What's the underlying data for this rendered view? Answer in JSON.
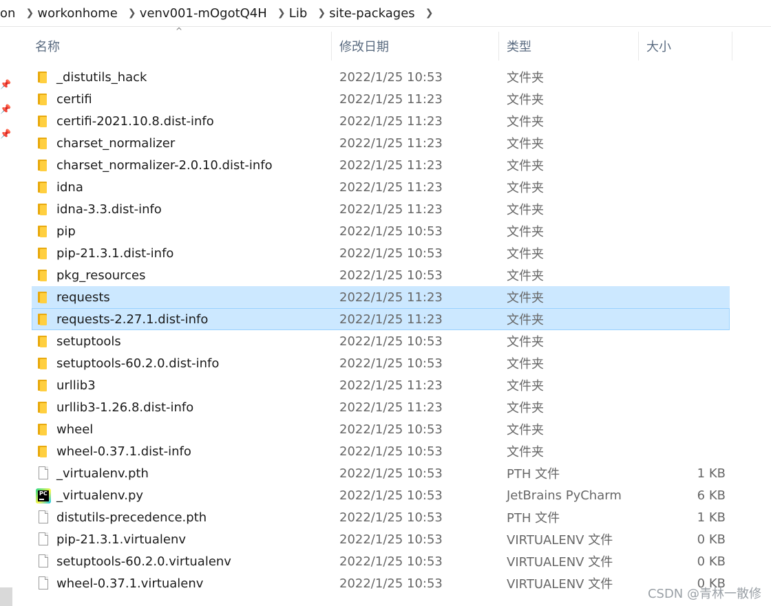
{
  "breadcrumb": [
    "on",
    "workonhome",
    "venv001-mOgotQ4H",
    "Lib",
    "site-packages"
  ],
  "breadcrumb_sep": "❯",
  "columns": {
    "name": "名称",
    "date": "修改日期",
    "type": "类型",
    "size": "大小"
  },
  "sort_indicator": "^",
  "pin_glyph": "📌",
  "rows": [
    {
      "name": "_distutils_hack",
      "date": "2022/1/25 10:53",
      "type": "文件夹",
      "size": "",
      "icon": "folder-icon"
    },
    {
      "name": "certifi",
      "date": "2022/1/25 11:23",
      "type": "文件夹",
      "size": "",
      "icon": "folder-icon"
    },
    {
      "name": "certifi-2021.10.8.dist-info",
      "date": "2022/1/25 11:23",
      "type": "文件夹",
      "size": "",
      "icon": "folder-icon"
    },
    {
      "name": "charset_normalizer",
      "date": "2022/1/25 11:23",
      "type": "文件夹",
      "size": "",
      "icon": "folder-icon"
    },
    {
      "name": "charset_normalizer-2.0.10.dist-info",
      "date": "2022/1/25 11:23",
      "type": "文件夹",
      "size": "",
      "icon": "folder-icon"
    },
    {
      "name": "idna",
      "date": "2022/1/25 11:23",
      "type": "文件夹",
      "size": "",
      "icon": "folder-icon"
    },
    {
      "name": "idna-3.3.dist-info",
      "date": "2022/1/25 11:23",
      "type": "文件夹",
      "size": "",
      "icon": "folder-icon"
    },
    {
      "name": "pip",
      "date": "2022/1/25 10:53",
      "type": "文件夹",
      "size": "",
      "icon": "folder-icon"
    },
    {
      "name": "pip-21.3.1.dist-info",
      "date": "2022/1/25 10:53",
      "type": "文件夹",
      "size": "",
      "icon": "folder-icon"
    },
    {
      "name": "pkg_resources",
      "date": "2022/1/25 10:53",
      "type": "文件夹",
      "size": "",
      "icon": "folder-icon"
    },
    {
      "name": "requests",
      "date": "2022/1/25 11:23",
      "type": "文件夹",
      "size": "",
      "icon": "folder-icon",
      "state": "selected"
    },
    {
      "name": "requests-2.27.1.dist-info",
      "date": "2022/1/25 11:23",
      "type": "文件夹",
      "size": "",
      "icon": "folder-icon",
      "state": "focused"
    },
    {
      "name": "setuptools",
      "date": "2022/1/25 10:53",
      "type": "文件夹",
      "size": "",
      "icon": "folder-icon"
    },
    {
      "name": "setuptools-60.2.0.dist-info",
      "date": "2022/1/25 10:53",
      "type": "文件夹",
      "size": "",
      "icon": "folder-icon"
    },
    {
      "name": "urllib3",
      "date": "2022/1/25 11:23",
      "type": "文件夹",
      "size": "",
      "icon": "folder-icon"
    },
    {
      "name": "urllib3-1.26.8.dist-info",
      "date": "2022/1/25 11:23",
      "type": "文件夹",
      "size": "",
      "icon": "folder-icon"
    },
    {
      "name": "wheel",
      "date": "2022/1/25 10:53",
      "type": "文件夹",
      "size": "",
      "icon": "folder-icon"
    },
    {
      "name": "wheel-0.37.1.dist-info",
      "date": "2022/1/25 10:53",
      "type": "文件夹",
      "size": "",
      "icon": "folder-icon"
    },
    {
      "name": "_virtualenv.pth",
      "date": "2022/1/25 10:53",
      "type": "PTH 文件",
      "size": "1 KB",
      "icon": "file-icon"
    },
    {
      "name": "_virtualenv.py",
      "date": "2022/1/25 10:53",
      "type": "JetBrains PyCharm",
      "size": "6 KB",
      "icon": "pycharm-icon"
    },
    {
      "name": "distutils-precedence.pth",
      "date": "2022/1/25 10:53",
      "type": "PTH 文件",
      "size": "1 KB",
      "icon": "file-icon"
    },
    {
      "name": "pip-21.3.1.virtualenv",
      "date": "2022/1/25 10:53",
      "type": "VIRTUALENV 文件",
      "size": "0 KB",
      "icon": "file-icon"
    },
    {
      "name": "setuptools-60.2.0.virtualenv",
      "date": "2022/1/25 10:53",
      "type": "VIRTUALENV 文件",
      "size": "0 KB",
      "icon": "file-icon"
    },
    {
      "name": "wheel-0.37.1.virtualenv",
      "date": "2022/1/25 10:53",
      "type": "VIRTUALENV 文件",
      "size": "0 KB",
      "icon": "file-icon"
    }
  ],
  "pycharm_badge": "PC",
  "watermark": "CSDN @青林一散修",
  "colors": {
    "selection": "#cce8ff",
    "focus_border": "#99d1ff",
    "header_text": "#5a6b80",
    "folder": "#ffcf40"
  }
}
